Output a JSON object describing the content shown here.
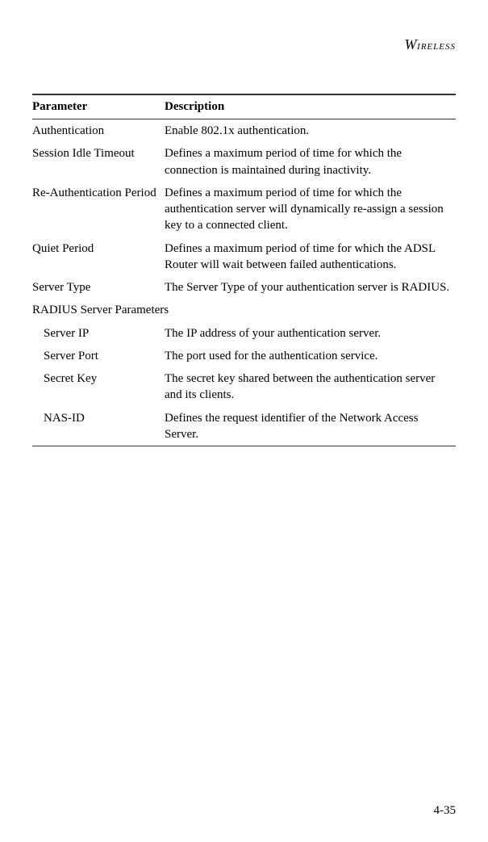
{
  "section_header": "WIRELESS",
  "table": {
    "header_param": "Parameter",
    "header_desc": "Description",
    "rows": [
      {
        "param": "Authentication",
        "desc": "Enable 802.1x authentication."
      },
      {
        "param": "Session Idle Timeout",
        "desc": "Defines a maximum period of time for which the connection is maintained during inactivity."
      },
      {
        "param": "Re-Authentication Period",
        "desc": "Defines a maximum period of time for which the authentication server will dynamically re-assign a session key to a connected client."
      },
      {
        "param": "Quiet Period",
        "desc": "Defines a maximum period of time for which the ADSL Router will wait between failed authentications."
      },
      {
        "param": "Server Type",
        "desc": "The Server Type of your authentication server is RADIUS."
      }
    ],
    "subsection_label": "RADIUS Server Parameters",
    "subrows": [
      {
        "param": "Server IP",
        "desc": "The IP address of your authentication server."
      },
      {
        "param": "Server Port",
        "desc": "The port used for the authentication service."
      },
      {
        "param": "Secret Key",
        "desc": "The secret key shared between the authentication server and its clients."
      },
      {
        "param": "NAS-ID",
        "desc": "Defines the request identifier of the Network Access Server."
      }
    ]
  },
  "page_number": "4-35"
}
